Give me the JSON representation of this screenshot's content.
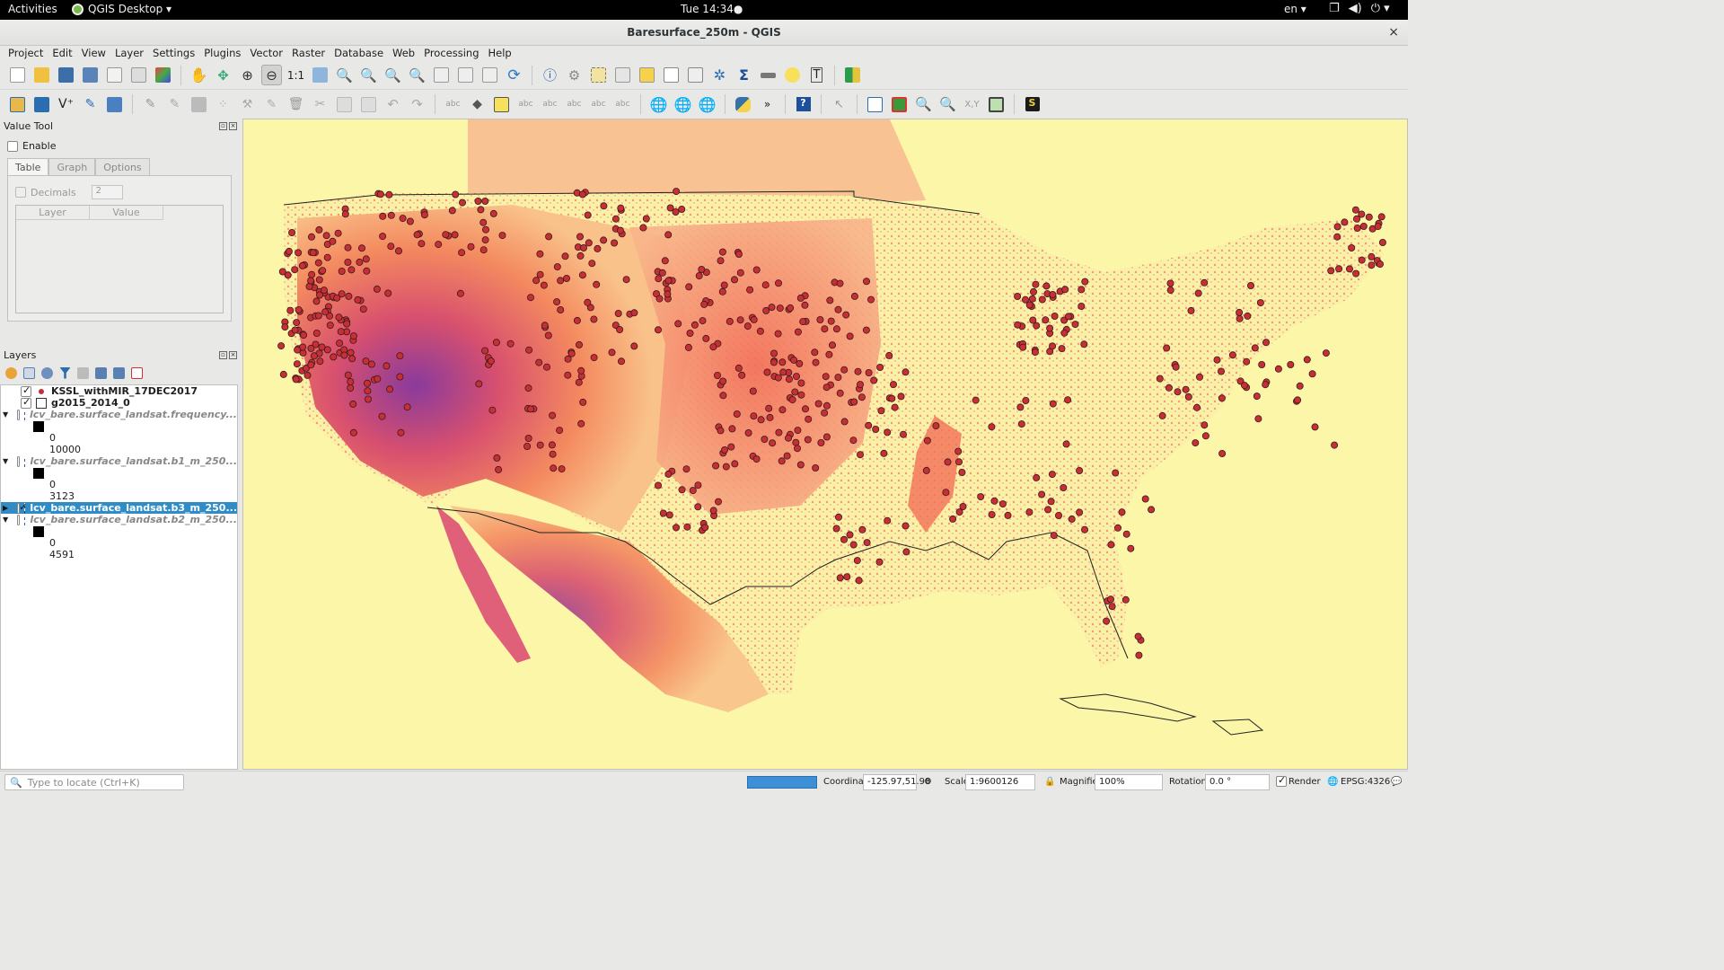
{
  "topbar": {
    "activities": "Activities",
    "app_name": "QGIS Desktop ▾",
    "clock": "Tue 14:34●",
    "lang": "en ▾"
  },
  "window": {
    "title": "Baresurface_250m - QGIS",
    "close": "×"
  },
  "menu": [
    "Project",
    "Edit",
    "View",
    "Layer",
    "Settings",
    "Plugins",
    "Vector",
    "Raster",
    "Database",
    "Web",
    "Processing",
    "Help"
  ],
  "value_tool": {
    "title": "Value Tool",
    "enable_label": "Enable",
    "tabs": [
      "Table",
      "Graph",
      "Options"
    ],
    "decimals_label": "Decimals",
    "decimals_value": "2",
    "columns": [
      "Layer",
      "Value"
    ]
  },
  "layers_panel": {
    "title": "Layers",
    "layers": [
      {
        "name": "KSSL_withMIR_17DEC2017",
        "checked": true,
        "expanded": null,
        "style": "normal"
      },
      {
        "name": "g2015_2014_0",
        "checked": true,
        "expanded": null,
        "style": "normal"
      },
      {
        "name": "lcv_bare.surface_landsat.frequency...",
        "checked": false,
        "expanded": true,
        "style": "grey",
        "legend": [
          "0",
          "10000"
        ]
      },
      {
        "name": "lcv_bare.surface_landsat.b1_m_250...",
        "checked": false,
        "expanded": true,
        "style": "grey",
        "legend": [
          "0",
          "3123"
        ]
      },
      {
        "name": "lcv_bare.surface_landsat.b3_m_250...",
        "checked": true,
        "expanded": false,
        "style": "selected"
      },
      {
        "name": "lcv_bare.surface_landsat.b2_m_250...",
        "checked": false,
        "expanded": true,
        "style": "grey",
        "legend": [
          "0",
          "4591"
        ]
      }
    ]
  },
  "statusbar": {
    "locator_placeholder": "Type to locate (Ctrl+K)",
    "coordinate_label": "Coordinate",
    "coordinate_value": "-125.97,51.98",
    "scale_label": "Scale",
    "scale_value": "1:9600126",
    "magnifier_label": "Magnifier",
    "magnifier_value": "100%",
    "rotation_label": "Rotation",
    "rotation_value": "0.0 °",
    "render_label": "Render",
    "crs": "EPSG:4326"
  },
  "colors": {
    "map_background": "#fbf6a8",
    "bare_low": "#fde0a0",
    "bare_mid": "#f58860",
    "bare_high": "#7b2a8c",
    "point_fill": "#c62f36",
    "selection": "#308cc6"
  }
}
